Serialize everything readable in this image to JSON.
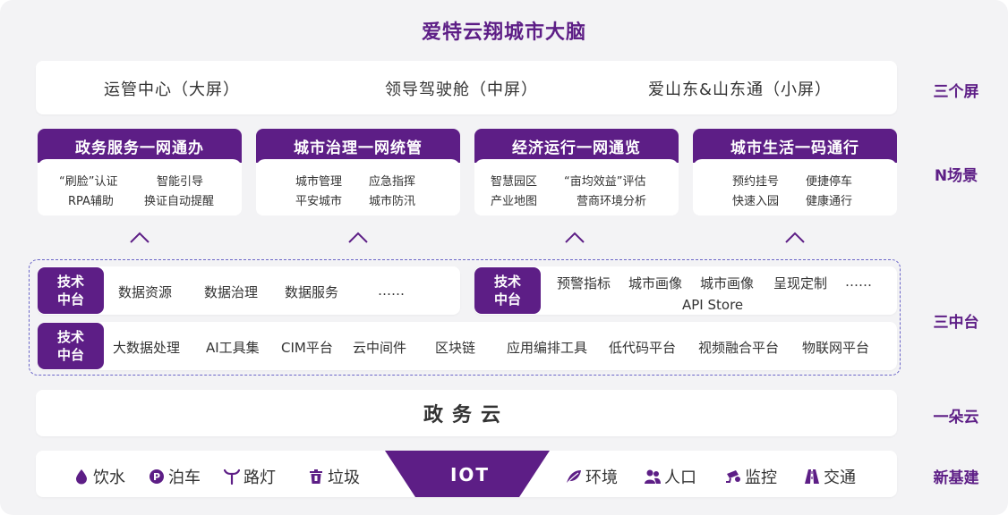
{
  "title": "爱特云翔城市大脑",
  "row_labels": {
    "screens": "三个屏",
    "scenarios": "N场景",
    "platforms": "三中台",
    "cloud": "一朵云",
    "infra": "新基建"
  },
  "screens": [
    "运管中心（大屏）",
    "领导驾驶舱（中屏）",
    "爱山东&山东通（小屏）"
  ],
  "scenarios": [
    {
      "title": "政务服务一网通办",
      "items": [
        "“刷脸”认证",
        "智能引导",
        "RPA辅助",
        "换证自动提醒"
      ]
    },
    {
      "title": "城市治理一网统管",
      "items": [
        "城市管理",
        "应急指挥",
        "平安城市",
        "城市防汛"
      ]
    },
    {
      "title": "经济运行一网通览",
      "items": [
        "智慧园区",
        "“亩均效益”评估",
        "产业地图",
        "营商环境分析"
      ]
    },
    {
      "title": "城市生活一码通行",
      "items": [
        "预约挂号",
        "便捷停车",
        "快速入园",
        "健康通行"
      ]
    }
  ],
  "platforms": {
    "badge": "技术\n中台",
    "badge_line1": "技术",
    "badge_line2": "中台",
    "data_row": [
      "数据资源",
      "数据治理",
      "数据服务",
      "……"
    ],
    "app_row": [
      "预警指标",
      "城市画像",
      "城市画像",
      "呈现定制",
      "……",
      "API Store"
    ],
    "tech_row": [
      "大数据处理",
      "AI工具集",
      "CIM平台",
      "云中间件",
      "区块链",
      "应用编排工具",
      "低代码平台",
      "视频融合平台",
      "物联网平台"
    ]
  },
  "cloud": "政务云",
  "infra": {
    "left": [
      {
        "label": "饮水",
        "icon": "water-drop-icon"
      },
      {
        "label": "泊车",
        "icon": "parking-icon"
      },
      {
        "label": "路灯",
        "icon": "street-lamp-icon"
      },
      {
        "label": "垃圾",
        "icon": "trash-bin-icon"
      }
    ],
    "center": "IOT",
    "right": [
      {
        "label": "环境",
        "icon": "leaf-icon"
      },
      {
        "label": "人口",
        "icon": "people-icon"
      },
      {
        "label": "监控",
        "icon": "camera-icon"
      },
      {
        "label": "交通",
        "icon": "road-icon"
      }
    ]
  },
  "colors": {
    "accent": "#5d1e86",
    "background": "#f3f3f5",
    "dash": "#6b66c8"
  }
}
